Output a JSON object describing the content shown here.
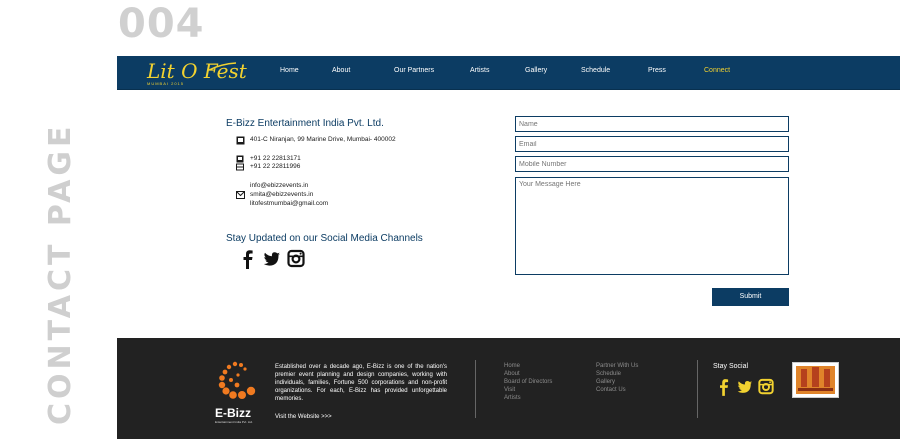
{
  "slide": {
    "page_number": "004",
    "side_title": "CONTACT PAGE"
  },
  "nav": {
    "logo": "Lit O Fest",
    "logo_sub": "MUMBAI 2015",
    "items": [
      "Home",
      "About",
      "Our Partners",
      "Artists",
      "Gallery",
      "Schedule",
      "Press",
      "Connect"
    ],
    "active": "Connect"
  },
  "contact": {
    "company": "E-Bizz Entertainment India Pvt. Ltd.",
    "address": "401-C Niranjan, 99 Marine Drive, Mumbai- 400002",
    "phones": [
      "+91 22 22813171",
      "+91 22 22811996"
    ],
    "emails": [
      "info@ebizzevents.in",
      "smita@ebizzevents.in",
      "litofestmumbai@gmail.com"
    ],
    "social_title": "Stay Updated on our Social Media Channels",
    "social_icons": [
      "facebook-icon",
      "twitter-icon",
      "instagram-icon"
    ]
  },
  "form": {
    "name_placeholder": "Name",
    "email_placeholder": "Email",
    "mobile_placeholder": "Mobile Number",
    "message_placeholder": "Your Message Here",
    "submit_label": "Submit"
  },
  "footer": {
    "brand": "E-Bizz",
    "brand_sub": "Entertainment India Pvt. Ltd.",
    "about": "Established over a decade ago, E-Bizz is one of the nation's premier event planning and design companies, working with individuals, families, Fortune 500 corporations and non-profit organizations. For each, E-Bizz has provided unforgettable memories.",
    "visit": "Visit the Website >>>",
    "links_col1": [
      "Home",
      "About",
      "Board of Directors",
      "Visit",
      "Artists"
    ],
    "links_col2": [
      "Partner With Us",
      "Schedule",
      "Gallery",
      "Contact Us"
    ],
    "social_title": "Stay Social"
  },
  "colors": {
    "navy": "#0c3c63",
    "yellow": "#f2d230",
    "footer_bg": "#222222",
    "ebizz_orange": "#f07a20"
  }
}
